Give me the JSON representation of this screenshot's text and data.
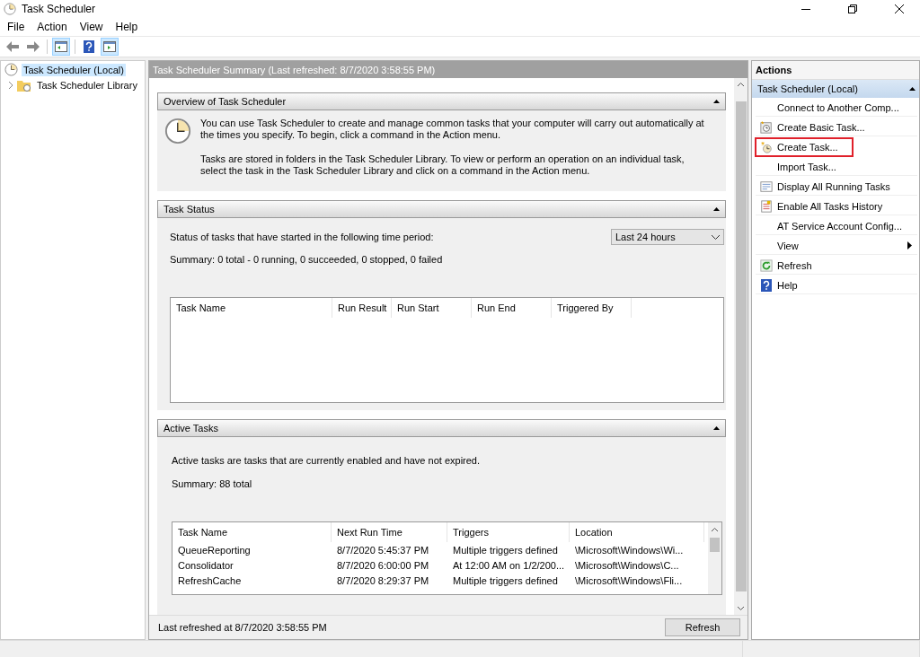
{
  "window": {
    "title": "Task Scheduler"
  },
  "menu": [
    "File",
    "Action",
    "View",
    "Help"
  ],
  "toolbar": [
    {
      "kind": "back",
      "pressed": false
    },
    {
      "kind": "forward",
      "pressed": false
    },
    {
      "kind": "tree",
      "pressed": true
    },
    {
      "kind": "help",
      "pressed": false
    },
    {
      "kind": "pane",
      "pressed": true
    }
  ],
  "tree": [
    {
      "label": "Task Scheduler (Local)",
      "selected": true
    },
    {
      "label": "Task Scheduler Library",
      "selected": false,
      "expanded": false
    }
  ],
  "summary": {
    "title": "Task Scheduler Summary (Last refreshed: 8/7/2020 3:58:55 PM)",
    "overview": {
      "title": "Overview of Task Scheduler",
      "paragraphs": [
        "You can use Task Scheduler to create and manage common tasks that your computer will carry out automatically at the times you specify. To begin, click a command in the Action menu.",
        "Tasks are stored in folders in the Task Scheduler Library. To view or perform an operation on an individual task, select the task in the Task Scheduler Library and click on a command in the Action menu."
      ]
    },
    "status": {
      "title": "Task Status",
      "period_label": "Status of tasks that have started in the following time period:",
      "period": "Last 24 hours",
      "summary": "Summary: 0 total - 0 running, 0 succeeded, 0 stopped, 0 failed",
      "columns": [
        "Task Name",
        "Run Result",
        "Run Start",
        "Run End",
        "Triggered By"
      ]
    },
    "active": {
      "title": "Active Tasks",
      "description": "Active tasks are tasks that are currently enabled and have not expired.",
      "summary": "Summary: 88 total",
      "columns": [
        "Task Name",
        "Next Run Time",
        "Triggers",
        "Location"
      ],
      "rows": [
        [
          "QueueReporting",
          "8/7/2020 5:45:37 PM",
          "Multiple triggers defined",
          "\\Microsoft\\Windows\\Wi..."
        ],
        [
          "Consolidator",
          "8/7/2020 6:00:00 PM",
          "At 12:00 AM on 1/2/200...",
          "\\Microsoft\\Windows\\C..."
        ],
        [
          "RefreshCache",
          "8/7/2020 8:29:37 PM",
          "Multiple triggers defined",
          "\\Microsoft\\Windows\\Fli..."
        ]
      ]
    },
    "footer": {
      "text": "Last refreshed at 8/7/2020 3:58:55 PM",
      "button": "Refresh"
    }
  },
  "actions": {
    "title": "Actions",
    "group": "Task Scheduler (Local)",
    "items": [
      {
        "label": "Connect to Another Comp...",
        "kind": "plain",
        "highlighted": false
      },
      {
        "label": "Create Basic Task...",
        "kind": "basic",
        "highlighted": false
      },
      {
        "label": "Create Task...",
        "kind": "create",
        "highlighted": true
      },
      {
        "label": "Import Task...",
        "kind": "plain",
        "highlighted": false
      },
      {
        "label": "Display All Running Tasks",
        "kind": "list",
        "highlighted": false
      },
      {
        "label": "Enable All Tasks History",
        "kind": "history",
        "highlighted": false
      },
      {
        "label": "AT Service Account Config...",
        "kind": "plain",
        "highlighted": false
      },
      {
        "label": "View",
        "kind": "submenu",
        "highlighted": false
      },
      {
        "label": "Refresh",
        "kind": "refresh",
        "highlighted": false
      },
      {
        "label": "Help",
        "kind": "help",
        "highlighted": false
      }
    ]
  }
}
